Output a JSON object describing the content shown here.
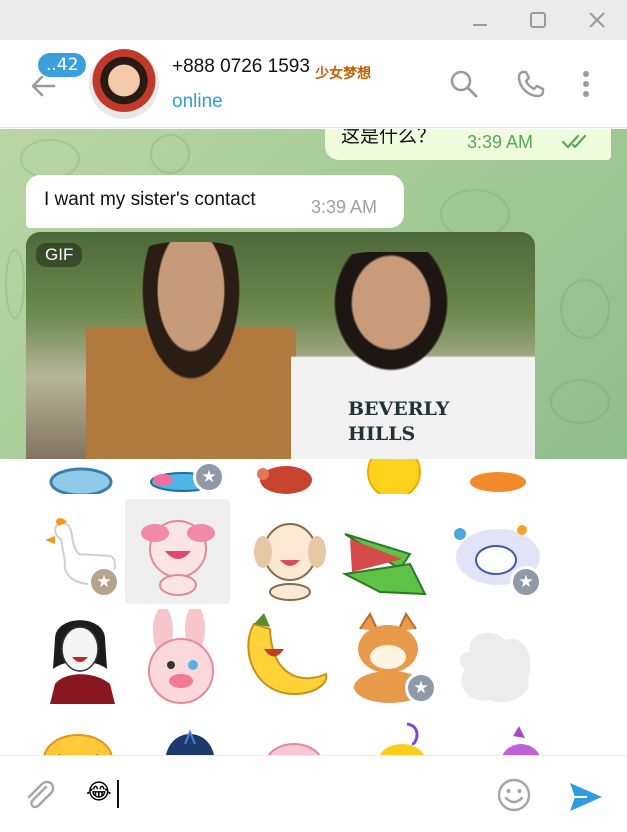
{
  "window": {
    "controls": [
      "minimize-icon",
      "maximize-icon",
      "close-icon"
    ]
  },
  "header": {
    "unread_count": "..42",
    "contact_number": "+888 0726 1593",
    "contact_name_tag": "少女梦想",
    "status": "online",
    "icons": [
      "back-arrow-icon",
      "search-icon",
      "phone-icon",
      "more-vertical-icon"
    ],
    "status_color": "#2f9be0",
    "badge_color": "#3aa0dc"
  },
  "messages": [
    {
      "direction": "outgoing",
      "text": "这是什么？",
      "time": "3:39 AM",
      "read": true
    },
    {
      "direction": "incoming",
      "text": "I want my sister's contact",
      "time": "3:39 AM"
    },
    {
      "direction": "incoming",
      "type": "gif",
      "label": "GIF",
      "shirt_text_line1": "BEVERLY",
      "shirt_text_line2": "HILLS"
    }
  ],
  "stickers": {
    "rows": [
      [
        "lizard-sticker",
        "fish-sticker",
        "red-creature-sticker",
        "sun-sticker",
        "orange-creature-sticker"
      ],
      [
        "goose-sticker",
        "pink-cat-laughing-sticker",
        "puppy-laughing-sticker",
        "crocodile-laughing-sticker",
        "astronaut-duck-sticker"
      ],
      [
        "woman-laughing-sticker",
        "pink-rabbit-laughing-sticker",
        "banana-laughing-sticker",
        "shiba-dog-sticker",
        "loading-placeholder-sticker"
      ],
      [
        "yellow-blob-sticker",
        "blue-hood-sticker",
        "pink-pig-sticker",
        "yellow-bird-sticker",
        "purple-bird-sticker"
      ]
    ]
  },
  "composer": {
    "input_value": "😂",
    "icons": [
      "paperclip-icon",
      "emoji-icon",
      "send-icon"
    ],
    "send_color": "#2f9be0"
  },
  "colors": {
    "outgoing_bubble": "#effdde",
    "incoming_bubble": "#ffffff",
    "read_checks": "#5aa65a"
  }
}
